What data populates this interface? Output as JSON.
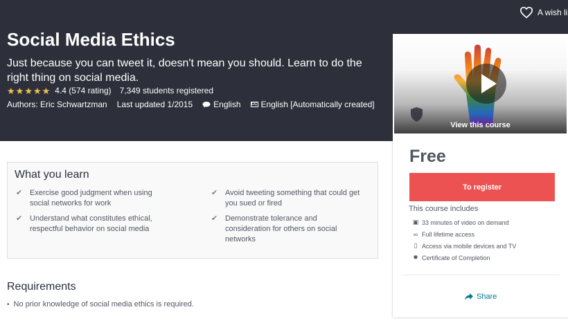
{
  "header": {
    "wishlist_label": "A wish lis",
    "title": "Social Media Ethics",
    "subtitle": "Just because you can tweet it, doesn't mean you should. Learn to do the right thing on social media.",
    "rating_stars": 4.4,
    "rating_text": "4.4 (574 rating)",
    "students": "7,349 students registered",
    "authors": "Authors: Eric Schwartzman",
    "last_updated": "Last updated 1/2015",
    "language": "English",
    "captions_icon_text": "CC",
    "captions": "English [Automatically created]"
  },
  "sidebar": {
    "view_course": "View this course",
    "price": "Free",
    "register_label": "To register",
    "includes_title": "This course includes",
    "includes": [
      {
        "icon": "video-icon",
        "glyph": "▣",
        "text": "33 minutes of video on demand"
      },
      {
        "icon": "infinity-icon",
        "glyph": "∞",
        "text": "Full lifetime access"
      },
      {
        "icon": "mobile-icon",
        "glyph": "▯",
        "text": "Access via mobile devices and TV"
      },
      {
        "icon": "certificate-icon",
        "glyph": "✹",
        "text": "Certificate of Completion"
      }
    ],
    "share_label": "Share"
  },
  "learn": {
    "title": "What you learn",
    "items": [
      "Exercise good judgment when using social networks for work",
      "Understand what constitutes ethical, respectful behavior on social media",
      "Avoid tweeting something that could get you sued or fired",
      "Demonstrate tolerance and consideration for others on social networks"
    ]
  },
  "requirements": {
    "title": "Requirements",
    "items": [
      "No prior knowledge of social media ethics is required."
    ]
  },
  "colors": {
    "hero_bg": "#2d303a",
    "accent_red": "#ec5252",
    "star": "#f4c150",
    "link": "#007791"
  }
}
